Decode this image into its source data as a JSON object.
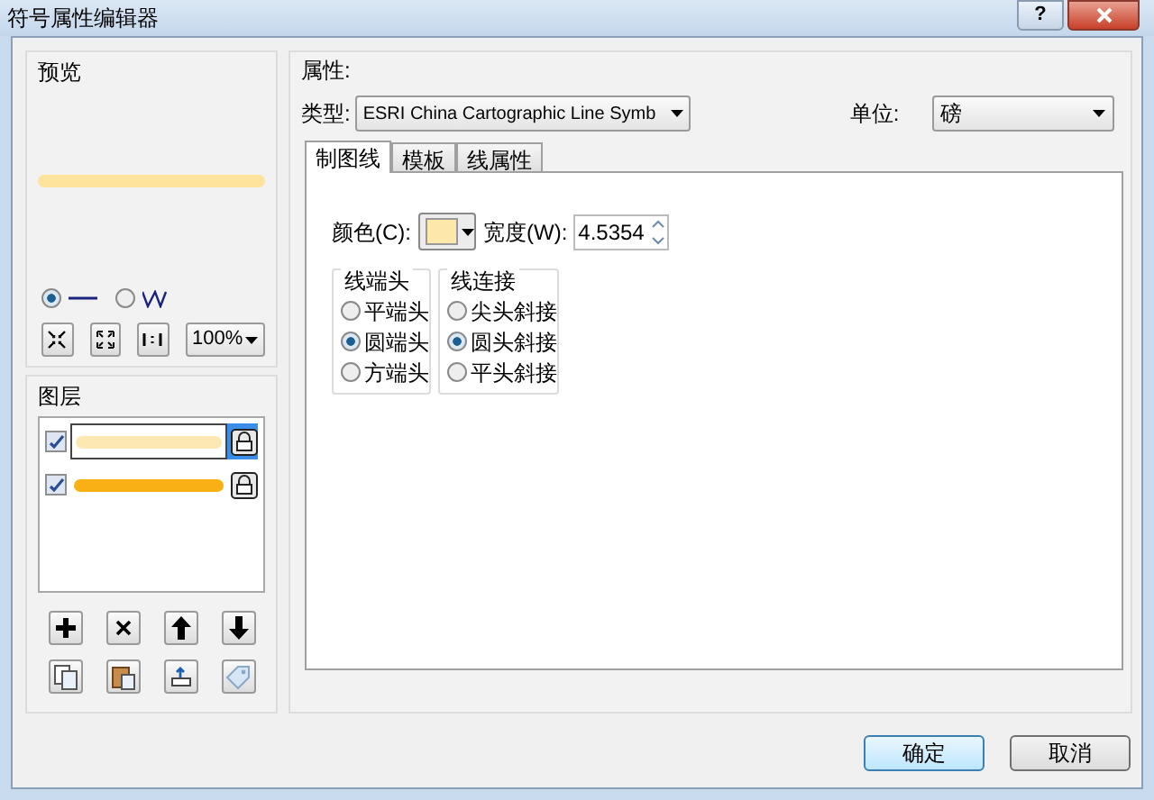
{
  "window": {
    "title": "符号属性编辑器",
    "help": "?"
  },
  "preview": {
    "label": "预览",
    "modes": [
      {
        "kind": "line",
        "selected": true
      },
      {
        "kind": "zigzag",
        "selected": false
      }
    ],
    "zoom": "100%"
  },
  "layers": {
    "label": "图层",
    "items": [
      {
        "checked": true,
        "selected": true,
        "color": "#fde8b4"
      },
      {
        "checked": true,
        "selected": false,
        "color": "#f8b014"
      }
    ]
  },
  "properties": {
    "label": "属性:",
    "type_label": "类型:",
    "type_value": "ESRI China Cartographic Line Symb",
    "unit_label": "单位:",
    "unit_value": "磅"
  },
  "tabs": [
    {
      "label": "制图线",
      "selected": true
    },
    {
      "label": "模板",
      "selected": false
    },
    {
      "label": "线属性",
      "selected": false
    }
  ],
  "line": {
    "color_label": "颜色(C):",
    "color": "#fde7aa",
    "width_label": "宽度(W):",
    "width_value": "4.5354"
  },
  "groups": [
    {
      "label": "线端头",
      "options": [
        {
          "label": "平端头",
          "selected": false
        },
        {
          "label": "圆端头",
          "selected": true
        },
        {
          "label": "方端头",
          "selected": false
        }
      ]
    },
    {
      "label": "线连接",
      "options": [
        {
          "label": "尖头斜接",
          "selected": false
        },
        {
          "label": "圆头斜接",
          "selected": true
        },
        {
          "label": "平头斜接",
          "selected": false
        }
      ]
    }
  ],
  "buttons": [
    {
      "label": "确定",
      "default": true
    },
    {
      "label": "取消",
      "default": false
    }
  ]
}
